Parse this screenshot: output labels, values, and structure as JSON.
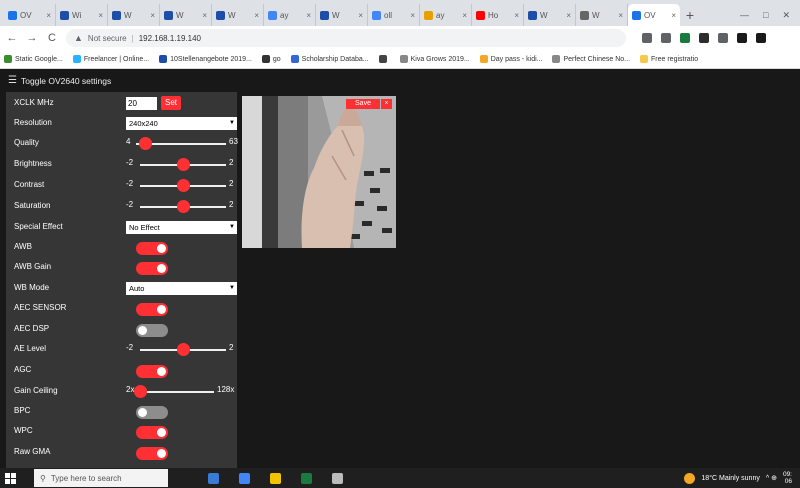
{
  "browser": {
    "tabs": [
      {
        "label": "OV",
        "color": "#1a73e8"
      },
      {
        "label": "Wi",
        "color": "#1d4ea8"
      },
      {
        "label": "W",
        "color": "#1d4ea8"
      },
      {
        "label": "W",
        "color": "#1d4ea8"
      },
      {
        "label": "W",
        "color": "#1d4ea8"
      },
      {
        "label": "ay",
        "color": "#4285f4"
      },
      {
        "label": "W",
        "color": "#1d4ea8"
      },
      {
        "label": "oll",
        "color": "#4285f4"
      },
      {
        "label": "ay",
        "color": "#e8a000"
      },
      {
        "label": "Ho",
        "color": "#ff0000"
      },
      {
        "label": "W",
        "color": "#1d4ea8"
      },
      {
        "label": "W",
        "color": "#666666"
      },
      {
        "label": "OV",
        "color": "#1a73e8",
        "active": true
      }
    ],
    "tab_close": "×",
    "new_tab": "+",
    "window_controls": [
      "—",
      "□",
      "✕"
    ],
    "nav": {
      "back": "←",
      "forward": "→",
      "reload": "C"
    },
    "address": {
      "warning_icon": "▲",
      "not_secure": "Not secure",
      "url": "192.168.1.19.140"
    },
    "extensions": [
      "#5f6368",
      "#5f6368",
      "#1b7a3e",
      "#2d2d2d",
      "#5f6368",
      "#1a1a1a",
      "#1a1a1a"
    ],
    "bookmarks": [
      {
        "label": "Static Google...",
        "color": "#3c8d2f"
      },
      {
        "label": "Freelancer | Online...",
        "color": "#29b2fe"
      },
      {
        "label": "10Stellenangebote 2019...",
        "color": "#1d4ea8"
      },
      {
        "label": "go",
        "color": "#333333"
      },
      {
        "label": "Scholarship Databa...",
        "color": "#3367d6"
      },
      {
        "label": "",
        "color": "#444444"
      },
      {
        "label": "Kiva Grows 2019...",
        "color": "#888888"
      },
      {
        "label": "Day pass - kidi...",
        "color": "#f5a623"
      },
      {
        "label": "Perfect Chinese No...",
        "color": "#888888"
      },
      {
        "label": "Free registratio",
        "color": "#f7c948"
      }
    ]
  },
  "page": {
    "menu_icon": "☰",
    "title": "Toggle OV2640 settings",
    "xclk": {
      "label": "XCLK MHz",
      "value": "20",
      "button": "Set"
    },
    "resolution": {
      "label": "Resolution",
      "value": "240x240"
    },
    "quality": {
      "label": "Quality",
      "min": "4",
      "max": "63",
      "value": 10,
      "min_v": 4,
      "max_v": 63
    },
    "brightness": {
      "label": "Brightness",
      "min": "-2",
      "max": "2",
      "value": 0,
      "min_v": -2,
      "max_v": 2
    },
    "contrast": {
      "label": "Contrast",
      "min": "-2",
      "max": "2",
      "value": 0,
      "min_v": -2,
      "max_v": 2
    },
    "saturation": {
      "label": "Saturation",
      "min": "-2",
      "max": "2",
      "value": 0,
      "min_v": -2,
      "max_v": 2
    },
    "special_effect": {
      "label": "Special Effect",
      "value": "No Effect"
    },
    "awb": {
      "label": "AWB",
      "on": true
    },
    "awb_gain": {
      "label": "AWB Gain",
      "on": true
    },
    "wb_mode": {
      "label": "WB Mode",
      "value": "Auto"
    },
    "aec_sensor": {
      "label": "AEC SENSOR",
      "on": true
    },
    "aec_dsp": {
      "label": "AEC DSP",
      "on": false
    },
    "ae_level": {
      "label": "AE Level",
      "min": "-2",
      "max": "2",
      "value": 0,
      "min_v": -2,
      "max_v": 2
    },
    "agc": {
      "label": "AGC",
      "on": true
    },
    "gain_ceiling": {
      "label": "Gain Ceiling",
      "min": "2x",
      "max": "128x",
      "value": 0,
      "min_v": 0,
      "max_v": 6
    },
    "bpc": {
      "label": "BPC",
      "on": false
    },
    "wpc": {
      "label": "WPC",
      "on": true
    },
    "raw_gma": {
      "label": "Raw GMA",
      "on": true
    },
    "stream": {
      "save": "Save",
      "close": "×"
    }
  },
  "taskbar": {
    "search_placeholder": "Type here to search",
    "search_icon": "⚲",
    "apps": [
      "#3a7bd5",
      "#4285f4",
      "#f5c400",
      "#1b7a3e",
      "#bbbbbb"
    ],
    "weather": "18°C  Mainly sunny",
    "tray_icons": "^ ⊕",
    "clock_time": "09:",
    "clock_date": "06"
  }
}
